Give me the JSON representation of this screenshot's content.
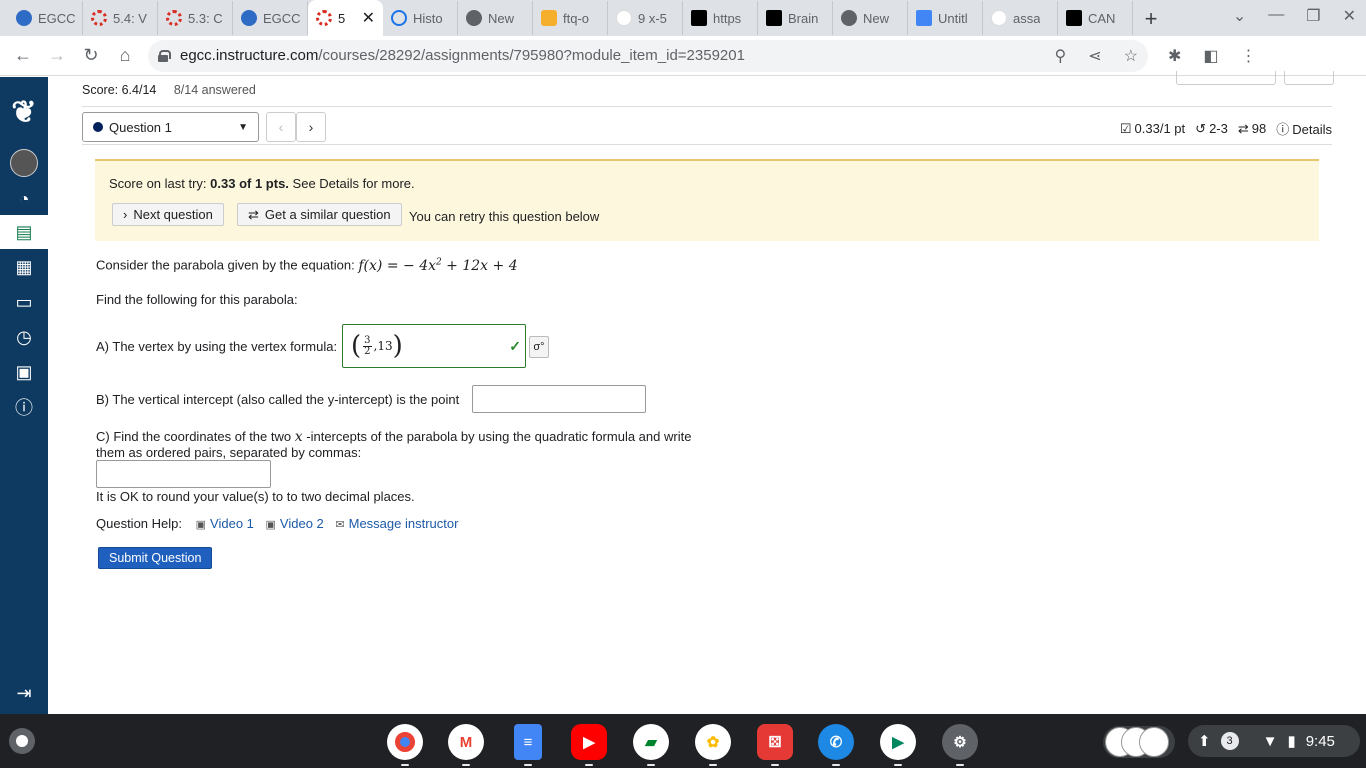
{
  "browser": {
    "tabs": [
      {
        "label": "EGCC",
        "favicon": "canvas-icon",
        "active": false
      },
      {
        "label": "5.4: V",
        "favicon": "ring-icon",
        "active": false
      },
      {
        "label": "5.3: C",
        "favicon": "ring-icon",
        "active": false
      },
      {
        "label": "EGCC",
        "favicon": "canvas-icon",
        "active": false
      },
      {
        "label": "5",
        "favicon": "ring-icon",
        "active": true
      },
      {
        "label": "Histo",
        "favicon": "history-icon",
        "active": false
      },
      {
        "label": "New",
        "favicon": "chrome-icon",
        "active": false
      },
      {
        "label": "ftq-o",
        "favicon": "ftq-icon",
        "active": false
      },
      {
        "label": "9 x-5",
        "favicon": "google-icon",
        "active": false
      },
      {
        "label": "https",
        "favicon": "brainly-icon",
        "active": false
      },
      {
        "label": "Brain",
        "favicon": "brainly-icon",
        "active": false
      },
      {
        "label": "New",
        "favicon": "chrome-icon",
        "active": false
      },
      {
        "label": "Untitl",
        "favicon": "docs-icon",
        "active": false
      },
      {
        "label": "assa",
        "favicon": "google-icon",
        "active": false
      },
      {
        "label": "CAN",
        "favicon": "brainly-icon",
        "active": false
      }
    ],
    "close_glyph": "✕",
    "newtab_glyph": "+",
    "url_host": "egcc.instructure.com",
    "url_path": "/courses/28292/assignments/795980?module_item_id=2359201"
  },
  "quiz": {
    "score": "Score: 6.4/14",
    "answered": "8/14 answered",
    "question_select": "Question 1",
    "points": "0.33/1 pt",
    "attempts": "2-3",
    "retries": "98",
    "details": "Details"
  },
  "banner": {
    "prefix": "Score on last try:",
    "score_bold": "0.33 of 1 pts.",
    "suffix": "See Details for more.",
    "next_button": "Next question",
    "similar_button": "Get a similar question",
    "retry_text": "You can retry this question below"
  },
  "question": {
    "intro": "Consider the parabola given by the equation:",
    "equation_lhs": "f(x) =",
    "equation_rhs_1": " − 4x",
    "equation_exp": "2",
    "equation_rhs_2": " + 12x + 4",
    "find": "Find the following for this parabola:",
    "part_a": "A) The vertex by using the vertex formula:",
    "answer_a_num": "3",
    "answer_a_den": "2",
    "answer_a_rest": ",13",
    "part_b": "B) The vertical intercept (also called the y-intercept) is the point",
    "part_c_1": "C) Find the coordinates of the two",
    "part_c_var": "x",
    "part_c_2": "-intercepts of the parabola by using the quadratic formula and write",
    "part_c_3": "them as ordered pairs, separated by commas:",
    "rounding": "It is OK to round your value(s) to to two decimal places.",
    "help_label": "Question Help:",
    "video1": "Video 1",
    "video2": "Video 2",
    "message": "Message instructor",
    "submit": "Submit Question"
  },
  "shelf": {
    "notification_count": "3",
    "time": "9:45"
  }
}
